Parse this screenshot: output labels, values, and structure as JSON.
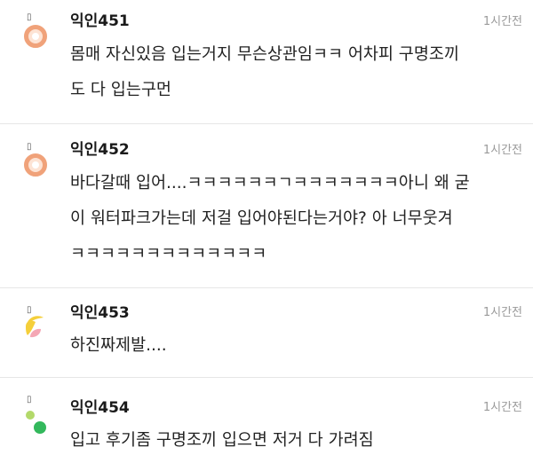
{
  "comments": [
    {
      "marker": "▯",
      "username": "익인451",
      "time": "1시간전",
      "avatar_icon": "peach-circle-avatar",
      "lines": [
        "몸매 자신있음 입는거지 무슨상관임ㅋㅋ 어차피 구명조끼",
        "도 다 입는구먼"
      ]
    },
    {
      "marker": "▯",
      "username": "익인452",
      "time": "1시간전",
      "avatar_icon": "peach-circle-avatar",
      "lines": [
        "바다갈때 입어....ㅋㅋㅋㅋㅋㅋㄱㅋㅋㅋㅋㅋㅋㅋ아니 왜 굳",
        "이 워터파크가는데 저걸 입어야된다는거야? 아 너무웃겨",
        "ㅋㅋㅋㅋㅋㅋㅋㅋㅋㅋㅋㅋㅋ"
      ]
    },
    {
      "marker": "▯",
      "username": "익인453",
      "time": "1시간전",
      "avatar_icon": "yellow-pink-shapes-avatar",
      "lines": [
        "하진짜제발...."
      ]
    },
    {
      "marker": "▯",
      "username": "익인454",
      "time": "1시간전",
      "avatar_icon": "green-dots-avatar",
      "lines": [
        "입고 후기좀 구명조끼 입으면 저거 다 가려짐"
      ]
    }
  ],
  "colors": {
    "peach_ring": "#f0a27a",
    "peach_fill": "#fde3d4",
    "yellow": "#f5cf3a",
    "pink": "#f4a7b4",
    "light_green": "#b3d96a",
    "green": "#33b85c",
    "divider": "#e6e6e6",
    "time": "#9a9a9a"
  }
}
